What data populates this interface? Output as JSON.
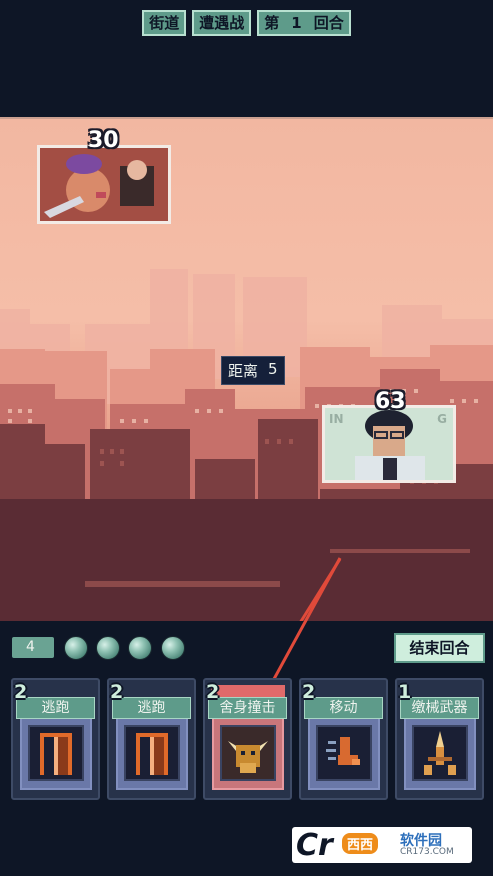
{
  "header": {
    "location": "街道",
    "encounter": "遭遇战",
    "round_prefix": "第",
    "round_number": "1",
    "round_suffix": "回合"
  },
  "battle": {
    "enemy_hp": "30",
    "player_hp": "63",
    "distance_label": "距离",
    "distance_value": "5",
    "player_card_text_top": "IN",
    "player_card_text_right": "G"
  },
  "controls": {
    "energy": "4",
    "orbs": 4,
    "end_turn_label": "结束回合"
  },
  "hand": [
    {
      "cost": "2",
      "name": "逃跑",
      "icon": "door-icon",
      "active": false
    },
    {
      "cost": "2",
      "name": "逃跑",
      "icon": "door-icon",
      "active": false
    },
    {
      "cost": "2",
      "name": "舍身撞击",
      "icon": "bull-icon",
      "active": true
    },
    {
      "cost": "2",
      "name": "移动",
      "icon": "boot-icon",
      "active": false
    },
    {
      "cost": "1",
      "name": "缴械武器",
      "icon": "disarm-icon",
      "active": false
    }
  ],
  "watermark": {
    "logo_c": "Cr",
    "logo_badge": "西西",
    "site_name": "软件园",
    "site_url": "CR173.COM"
  },
  "colors": {
    "background": "#0e1626",
    "accent_teal": "#5e9b8a",
    "sky_peach": "#f2b7a1",
    "arrow_red": "#e04a3a"
  }
}
